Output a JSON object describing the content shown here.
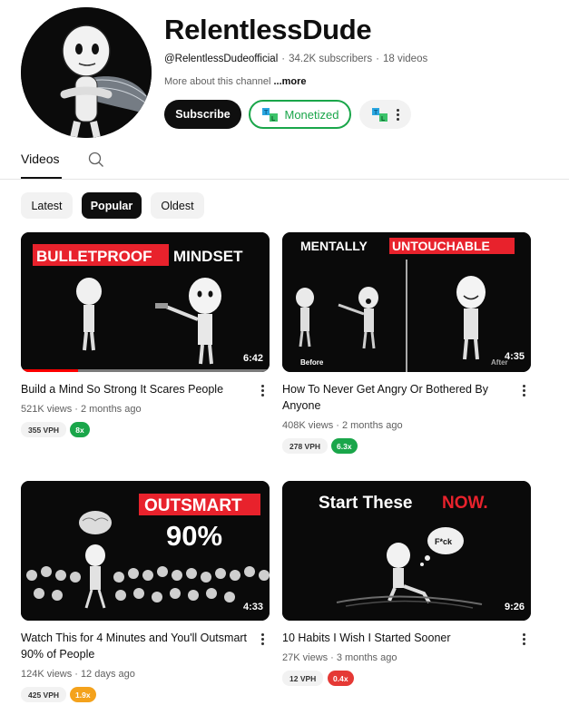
{
  "channel": {
    "name": "RelentlessDude",
    "handle": "@RelentlessDudeofficial",
    "subscribers": "34.2K subscribers",
    "videos_count": "18 videos",
    "about_prefix": "More about this channel ",
    "about_more": "...more",
    "subscribe_label": "Subscribe",
    "monetized_label": "Monetized"
  },
  "tabs": {
    "videos_label": "Videos"
  },
  "filters": [
    "Latest",
    "Popular",
    "Oldest"
  ],
  "colors": {
    "green": "#1aa64a",
    "orange": "#f4a21c",
    "red": "#e53935",
    "progress": "#ff0000"
  },
  "videos": [
    {
      "title": "Build a Mind So Strong It Scares People",
      "views": "521K views",
      "age": "2 months ago",
      "duration": "6:42",
      "vph": "355 VPH",
      "ratio": "8x",
      "ratio_color": "green",
      "watched_fraction": 0.23,
      "thumb_text_a": "BULLETPROOF",
      "thumb_text_b": "MINDSET"
    },
    {
      "title": "How To Never Get Angry Or Bothered By Anyone",
      "views": "408K views",
      "age": "2 months ago",
      "duration": "4:35",
      "vph": "278 VPH",
      "ratio": "6.3x",
      "ratio_color": "green",
      "thumb_text_a": "MENTALLY",
      "thumb_text_b": "UNTOUCHABLE",
      "thumb_before": "Before",
      "thumb_after": "After"
    },
    {
      "title": "Watch This for 4 Minutes and You'll Outsmart 90% of People",
      "views": "124K views",
      "age": "12 days ago",
      "duration": "4:33",
      "vph": "425 VPH",
      "ratio": "1.9x",
      "ratio_color": "orange",
      "thumb_text_a": "OUTSMART",
      "thumb_text_b": "90%"
    },
    {
      "title": "10 Habits I Wish I Started Sooner",
      "views": "27K views",
      "age": "3 months ago",
      "duration": "9:26",
      "vph": "12 VPH",
      "ratio": "0.4x",
      "ratio_color": "red",
      "thumb_text_a": "Start These",
      "thumb_text_b": "NOW.",
      "thumb_bubble": "F*ck"
    }
  ]
}
